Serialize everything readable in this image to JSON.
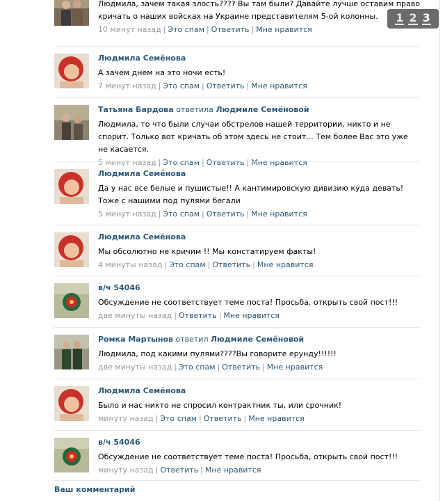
{
  "pager": {
    "pages": [
      "1",
      "2",
      "3"
    ],
    "current": "3"
  },
  "reply_word": "ответила",
  "reply_word_m": "ответил",
  "actions": {
    "spam": "Это спам",
    "reply": "Ответить",
    "like": "Мне нравится"
  },
  "comments": [
    {
      "author": "",
      "text": "Людмила, зачем такая злость???? Вы там были? Давайте лучше оставим право кричать о наших войсках на Украине представителям 5-ой колонны.",
      "time": "10 минут назад"
    },
    {
      "author": "Людмила Семёнова",
      "text": "А зачем днем на это ночи есть!",
      "time": "7 минут назад"
    },
    {
      "author": "Татьяна Бардова",
      "reply_to": "Людмиле Семёновой",
      "text": "Людмила, то что были случаи обстрелов нашей территории, никто и не спорит. Только вот кричать об этом здесь не стоит... Тем более Вас это уже не касается.",
      "time": "5 минут назад"
    },
    {
      "author": "Людмила Семёнова",
      "text": "Да у нас все белые и пушистые!! А кантимировскую дивизию куда девать! Тоже с нашими под пулями бегали",
      "time": "5 минут назад"
    },
    {
      "author": "Людмила Семёнова",
      "text": "Мы обсолютно не кричим !! Мы констатируем факты!",
      "time": "4 минуты назад"
    },
    {
      "author": "в/ч 54046",
      "text": "Обсуждение не соответствует теме поста! Просьба, открыть свой пост!!!",
      "time": "две минуты назад"
    },
    {
      "author": "Ромка Мартынов",
      "reply_to": "Людмиле Семёновой",
      "text": "Людмила, под какими пулями????Вы говорите ерунду!!!!!!",
      "time": "две минуты назад"
    },
    {
      "author": "Людмила Семёнова",
      "text": "Было и нас никто не спросил контрактник ты, или срочник!",
      "time": "минуту назад"
    },
    {
      "author": "в/ч 54046",
      "text": "Обсуждение не соответствует теме поста! Просьба, открыть свой пост!!!",
      "time": "минуту назад"
    }
  ],
  "footer": {
    "title": "Ваш комментарий"
  },
  "colors": {
    "link": "#2b587a",
    "meta": "#999999",
    "divider": "#e4e8ed",
    "pager_bg": "#6b6b6b"
  }
}
